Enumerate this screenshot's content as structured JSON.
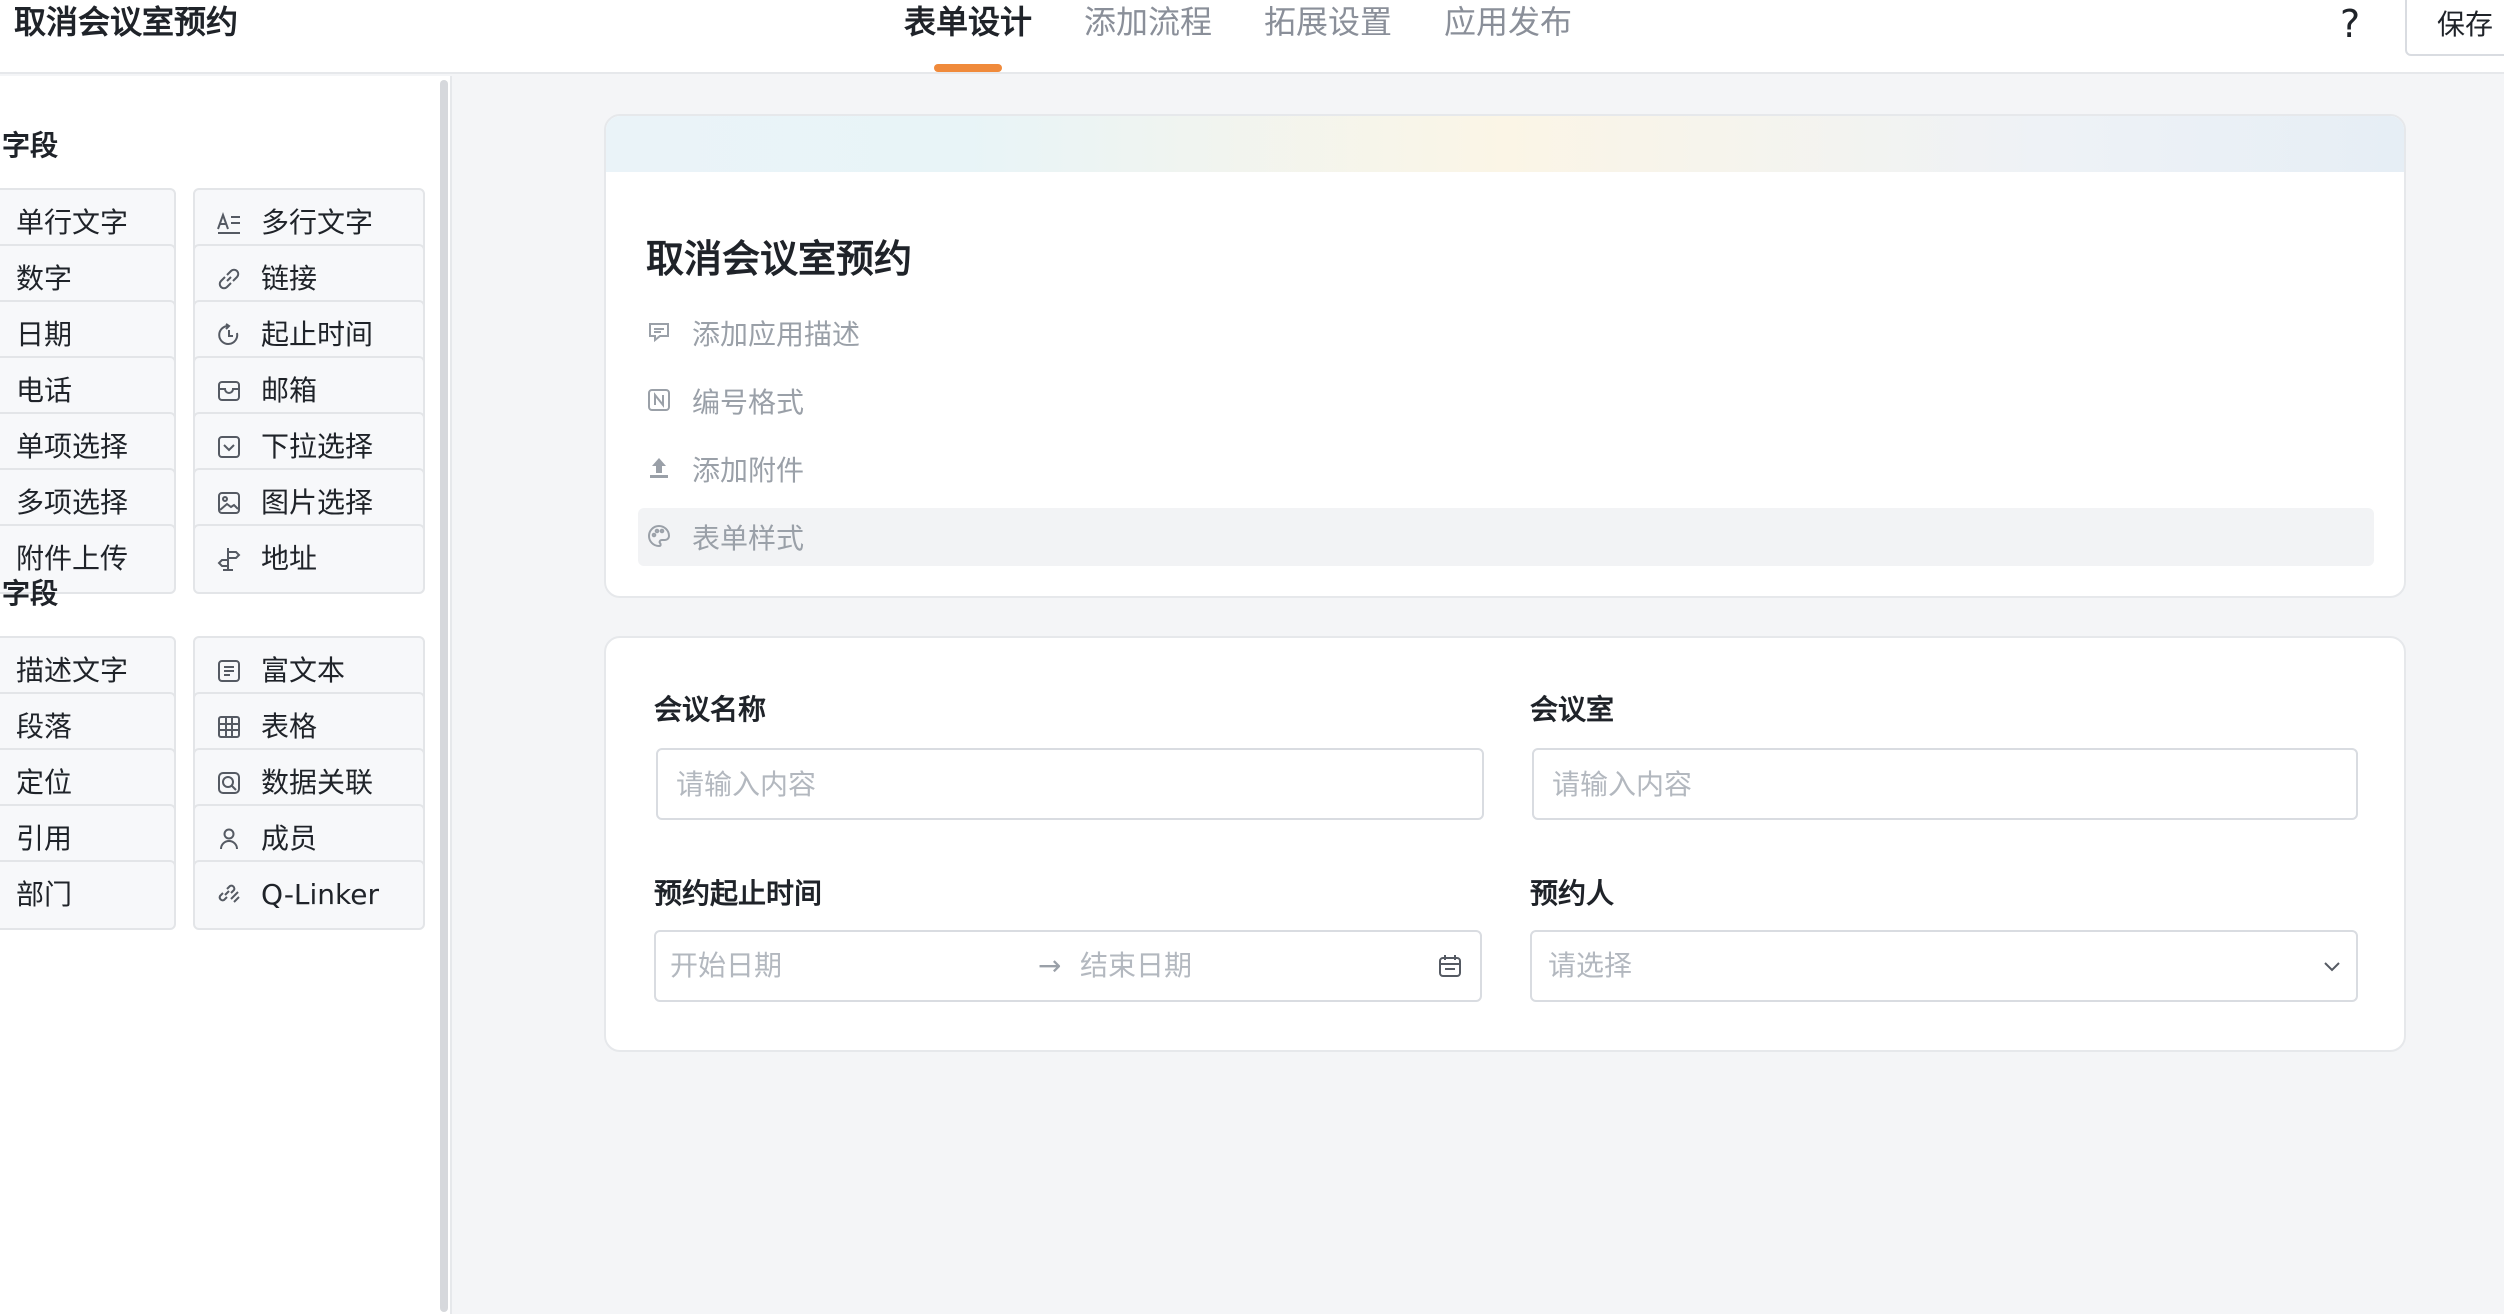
{
  "header": {
    "app_title": "取消会议室预约",
    "tabs": [
      {
        "label": "表单设计",
        "active": true
      },
      {
        "label": "添加流程",
        "active": false
      },
      {
        "label": "拓展设置",
        "active": false
      },
      {
        "label": "应用发布",
        "active": false
      }
    ],
    "help_label": "?",
    "save_label": "保存"
  },
  "sidebar": {
    "group1_title": "字段",
    "group1_items": [
      {
        "label": "单行文字",
        "icon": ""
      },
      {
        "label": "多行文字",
        "icon": "multiline-text-icon"
      },
      {
        "label": "数字",
        "icon": ""
      },
      {
        "label": "链接",
        "icon": "link-icon"
      },
      {
        "label": "日期",
        "icon": ""
      },
      {
        "label": "起止时间",
        "icon": "time-range-icon"
      },
      {
        "label": "电话",
        "icon": ""
      },
      {
        "label": "邮箱",
        "icon": "mailbox-icon"
      },
      {
        "label": "单项选择",
        "icon": ""
      },
      {
        "label": "下拉选择",
        "icon": "dropdown-icon"
      },
      {
        "label": "多项选择",
        "icon": ""
      },
      {
        "label": "图片选择",
        "icon": "image-icon"
      },
      {
        "label": "附件上传",
        "icon": ""
      },
      {
        "label": "地址",
        "icon": "signpost-icon"
      }
    ],
    "group2_title": "字段",
    "group2_items": [
      {
        "label": "描述文字",
        "icon": ""
      },
      {
        "label": "富文本",
        "icon": "rich-text-icon"
      },
      {
        "label": "段落",
        "icon": ""
      },
      {
        "label": "表格",
        "icon": "table-icon"
      },
      {
        "label": "定位",
        "icon": ""
      },
      {
        "label": "数据关联",
        "icon": "data-link-icon"
      },
      {
        "label": "引用",
        "icon": ""
      },
      {
        "label": "成员",
        "icon": "person-icon"
      },
      {
        "label": "部门",
        "icon": ""
      },
      {
        "label": "Q-Linker",
        "icon": "linker-icon"
      }
    ]
  },
  "form_header": {
    "title": "取消会议室预约",
    "meta": [
      {
        "label": "添加应用描述",
        "icon": "comment-icon"
      },
      {
        "label": "编号格式",
        "icon": "number-format-icon"
      },
      {
        "label": "添加附件",
        "icon": "upload-icon"
      },
      {
        "label": "表单样式",
        "icon": "palette-icon"
      }
    ]
  },
  "form": {
    "meeting_name_label": "会议名称",
    "meeting_name_placeholder": "请输入内容",
    "room_label": "会议室",
    "room_placeholder": "请输入内容",
    "time_label": "预约起止时间",
    "start_placeholder": "开始日期",
    "range_arrow": "→",
    "end_placeholder": "结束日期",
    "booker_label": "预约人",
    "booker_placeholder": "请选择"
  }
}
